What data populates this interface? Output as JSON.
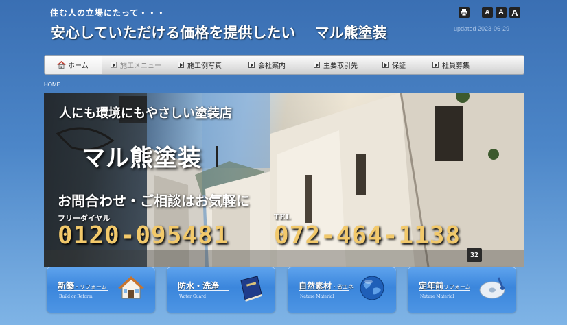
{
  "header": {
    "tagline": "住む人の立場にたって・・・",
    "headline": "安心していただける価格を提供したい　 マル熊塗装",
    "updated": "updated 2023-06-29",
    "font_size_buttons": [
      "A",
      "A",
      "A"
    ]
  },
  "nav": {
    "items": [
      {
        "label": "ホーム",
        "icon": "home-icon"
      },
      {
        "label": "施工メニュー"
      },
      {
        "label": "施工例写真"
      },
      {
        "label": "会社案内"
      },
      {
        "label": "主要取引先"
      },
      {
        "label": "保証"
      },
      {
        "label": "社員募集"
      }
    ]
  },
  "breadcrumb": "HOME",
  "hero": {
    "tagline": "人にも環境にもやさしい塗装店",
    "brand": "マル熊塗装",
    "contact": "お問合わせ・ご相談はお気軽に",
    "free_label": "フリーダイヤル",
    "free_number": "0120-095481",
    "tel_label": "TEL",
    "tel_number": "072-464-1138",
    "house_number": "32"
  },
  "cards": [
    {
      "title": "新築",
      "title_small": "・リフォーム",
      "sub": "Build or Reform",
      "icon": "house-icon"
    },
    {
      "title": "防水・洗浄",
      "title_small": "",
      "sub": "Water Guard",
      "icon": "book-icon"
    },
    {
      "title": "自然素材",
      "title_small": "・省エネ",
      "sub": "Nature Material",
      "icon": "globe-icon"
    },
    {
      "title": "定年前",
      "title_small": "リフォーム",
      "sub": "Nature Material",
      "icon": "disc-icon"
    }
  ],
  "colors": {
    "background": "#4c86c8",
    "accent_gold": "#f2c96b",
    "card_blue": "#3b86dc"
  }
}
